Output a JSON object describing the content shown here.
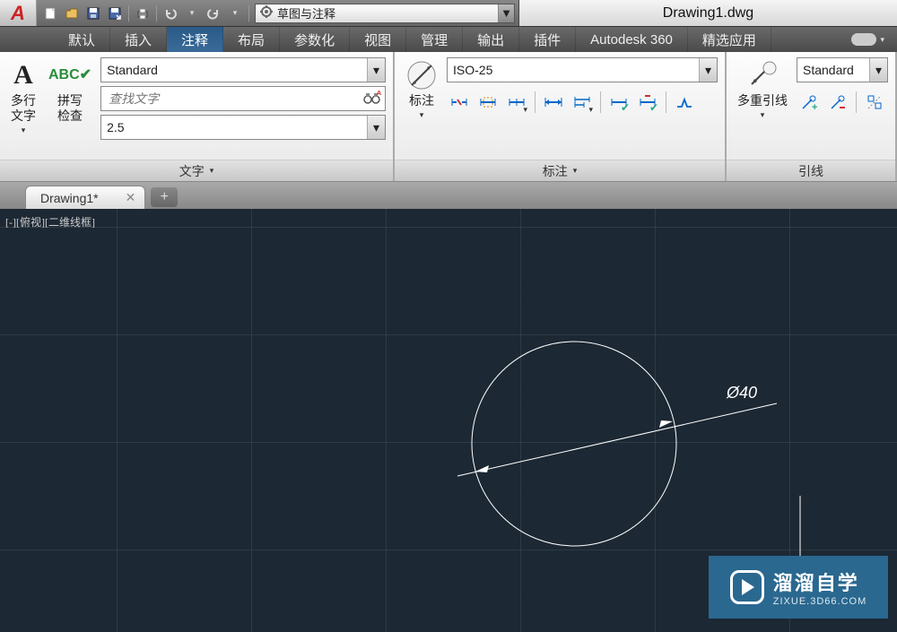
{
  "title": "Drawing1.dwg",
  "workspace": {
    "label": "草图与注释"
  },
  "menutabs": {
    "items": [
      "默认",
      "插入",
      "注释",
      "布局",
      "参数化",
      "视图",
      "管理",
      "输出",
      "插件",
      "Autodesk 360",
      "精选应用"
    ],
    "active": 2
  },
  "ribbon": {
    "text_panel": {
      "title": "文字",
      "mtext": "多行\n文字",
      "spell": "拼写\n检查",
      "style": "Standard",
      "search_placeholder": "查找文字",
      "height": "2.5"
    },
    "dim_panel": {
      "title": "标注",
      "dim_btn": "标注",
      "style": "ISO-25"
    },
    "leader_panel": {
      "title": "引线",
      "leader_btn": "多重引线",
      "style": "Standard"
    }
  },
  "doctab": {
    "label": "Drawing1*"
  },
  "viewport_label": "[-][俯视][二维线框]",
  "dimension_text": "Ø40",
  "watermark": {
    "title": "溜溜自学",
    "sub": "ZIXUE.3D66.COM"
  }
}
